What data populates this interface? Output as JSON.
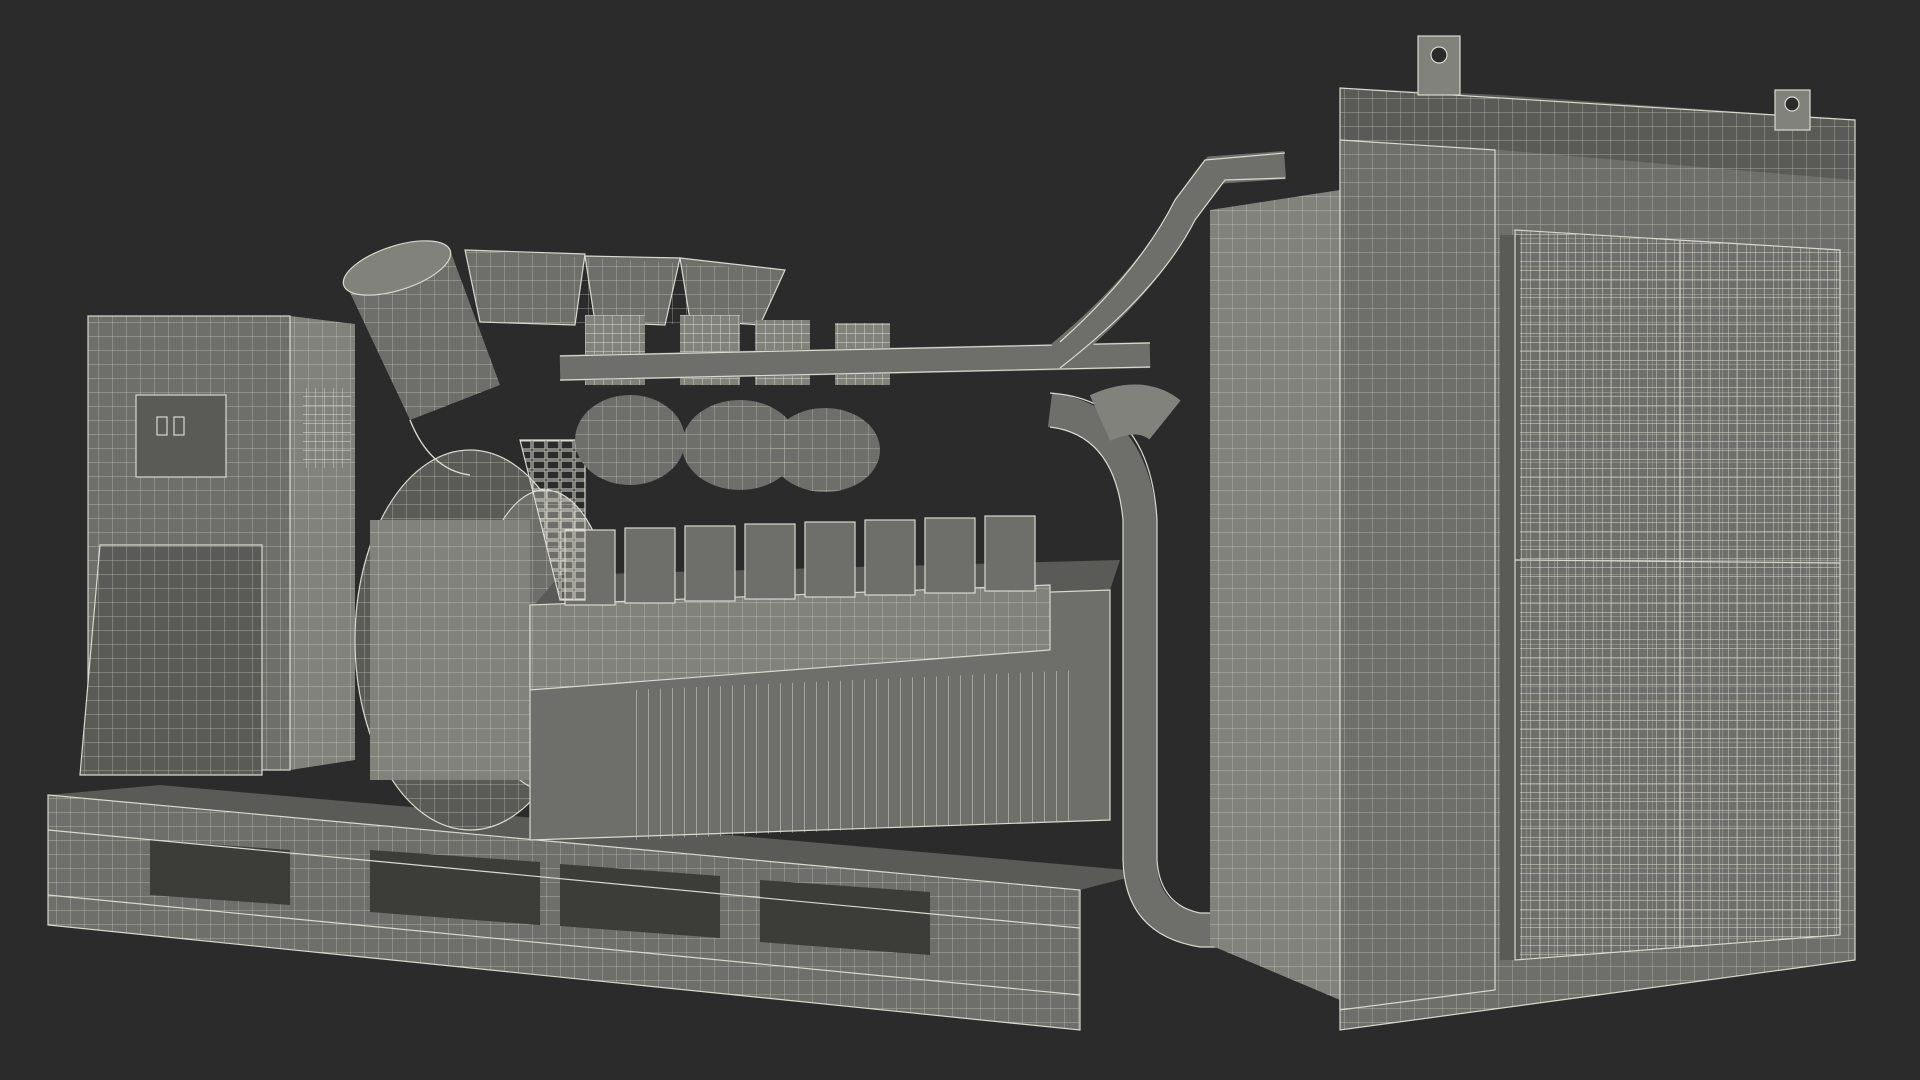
{
  "image": {
    "subject": "wireframe-render",
    "colors": {
      "background": "#2b2b2b",
      "body_fill": "#6e6e6a",
      "body_dark": "#5a5a56",
      "body_light": "#82827d",
      "wire": "#d9d9cf",
      "wire_dim": "#b4b4aa",
      "recess": "#3c3c39"
    }
  }
}
